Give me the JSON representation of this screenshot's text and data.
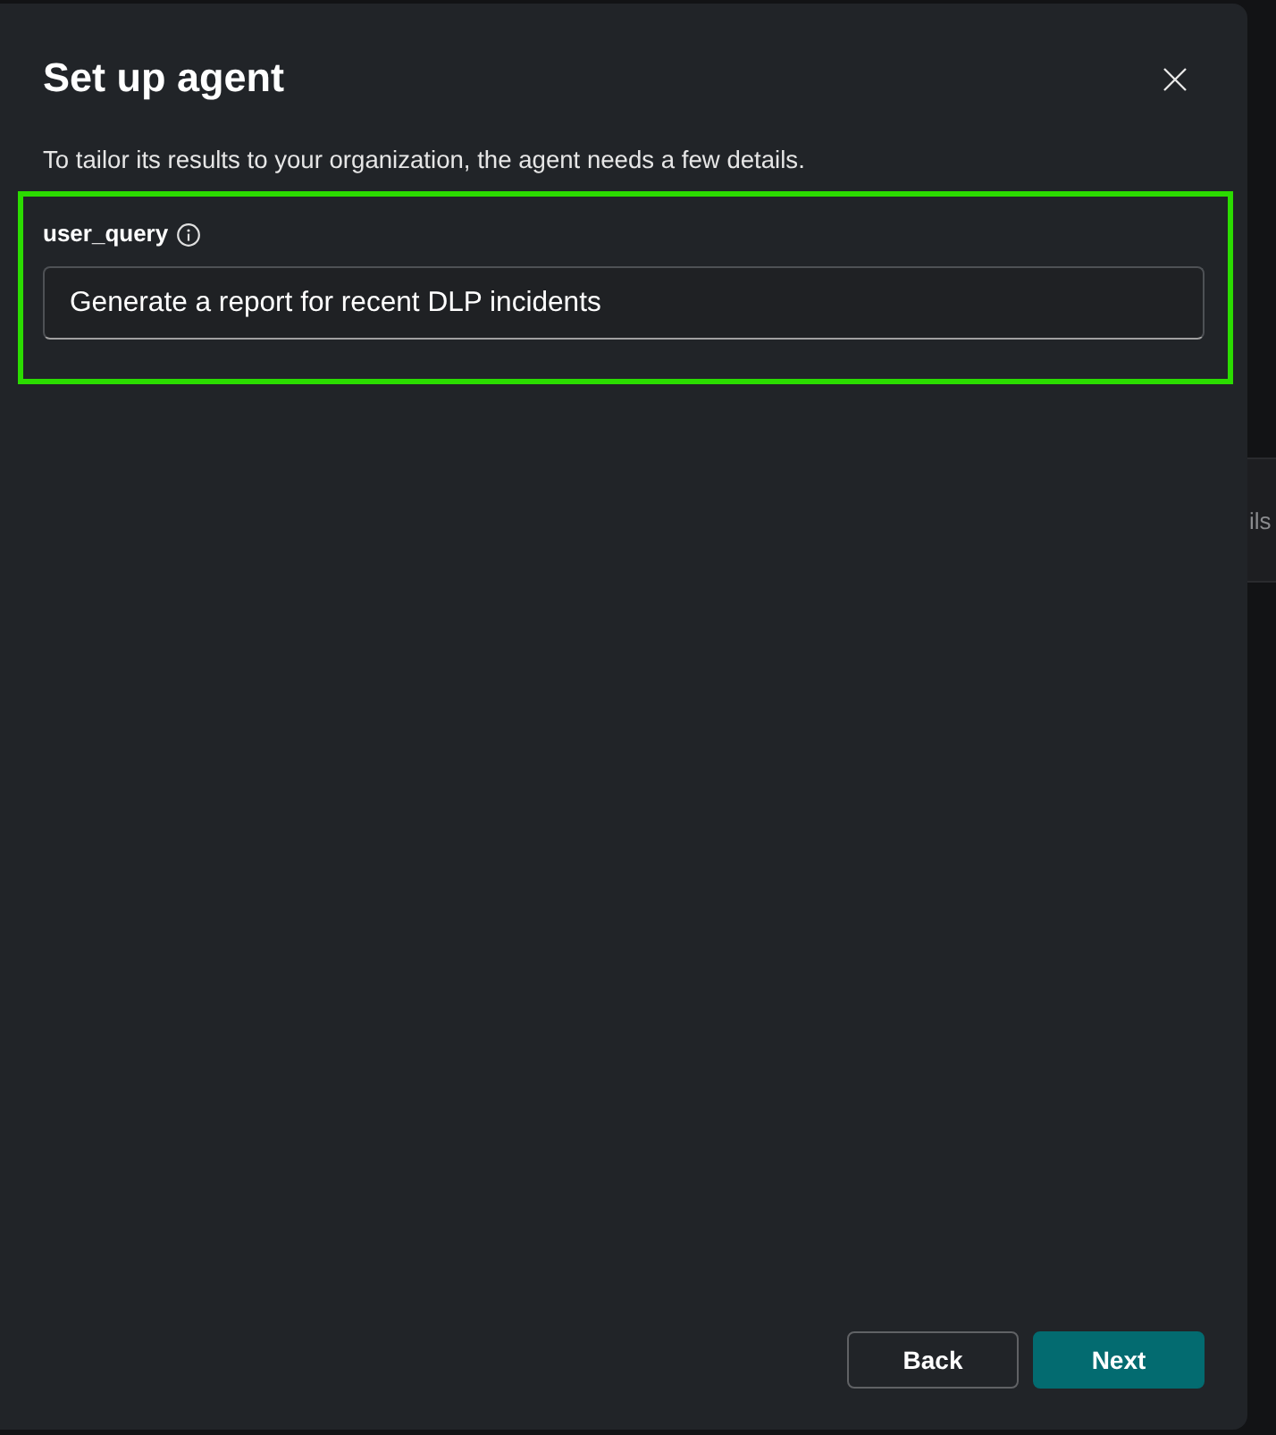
{
  "dialog": {
    "title": "Set up agent",
    "description": "To tailor its results to your organization, the agent needs a few details.",
    "fields": [
      {
        "label": "user_query",
        "value": "Generate a report for recent DLP incidents",
        "highlighted": true
      }
    ],
    "buttons": [
      {
        "label": "Back",
        "kind": "secondary"
      },
      {
        "label": "Next",
        "kind": "primary"
      }
    ]
  },
  "background": {
    "text": "ils"
  }
}
